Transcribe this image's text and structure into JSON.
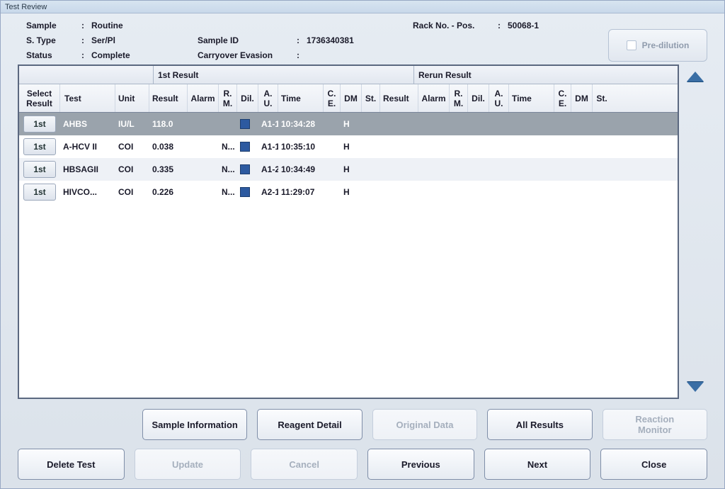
{
  "window_title": "Test Review",
  "info": {
    "sample_label": "Sample",
    "sample_value": "Routine",
    "stype_label": "S. Type",
    "stype_value": "Ser/Pl",
    "status_label": "Status",
    "status_value": "Complete",
    "sample_id_label": "Sample ID",
    "sample_id_value": "1736340381",
    "carryover_label": "Carryover Evasion",
    "carryover_value": "",
    "rack_label": "Rack No. - Pos.",
    "rack_value": "50068-1"
  },
  "predilution_label": "Pre-dilution",
  "group_headers": {
    "first": "1st Result",
    "rerun": "Rerun Result"
  },
  "columns": {
    "select_result": "Select\nResult",
    "test": "Test",
    "unit": "Unit",
    "result": "Result",
    "alarm": "Alarm",
    "rm": "R. M.",
    "dil": "Dil.",
    "au": "A. U.",
    "time": "Time",
    "ce": "C. E.",
    "dm": "DM",
    "st": "St."
  },
  "rows": [
    {
      "btn": "1st",
      "test": "AHBS",
      "unit": "IU/L",
      "result": "118.0",
      "alarm": "",
      "rm": "",
      "au": "A1-1",
      "time": "10:34:28",
      "ce": "",
      "dm": "H",
      "st": "",
      "selected": true
    },
    {
      "btn": "1st",
      "test": "A-HCV II",
      "unit": "COI",
      "result": "0.038",
      "alarm": "",
      "rm": "N...",
      "au": "A1-1",
      "time": "10:35:10",
      "ce": "",
      "dm": "H",
      "st": "",
      "selected": false
    },
    {
      "btn": "1st",
      "test": "HBSAGII",
      "unit": "COI",
      "result": "0.335",
      "alarm": "",
      "rm": "N...",
      "au": "A1-2",
      "time": "10:34:49",
      "ce": "",
      "dm": "H",
      "st": "",
      "selected": false
    },
    {
      "btn": "1st",
      "test": "HIVCO...",
      "unit": "COI",
      "result": "0.226",
      "alarm": "",
      "rm": "N...",
      "au": "A2-1",
      "time": "11:29:07",
      "ce": "",
      "dm": "H",
      "st": "",
      "selected": false
    }
  ],
  "buttons": {
    "sample_info": "Sample Information",
    "reagent_detail": "Reagent Detail",
    "original_data": "Original Data",
    "all_results": "All Results",
    "reaction_monitor": "Reaction\nMonitor",
    "delete_test": "Delete Test",
    "update": "Update",
    "cancel": "Cancel",
    "previous": "Previous",
    "next": "Next",
    "close": "Close"
  }
}
